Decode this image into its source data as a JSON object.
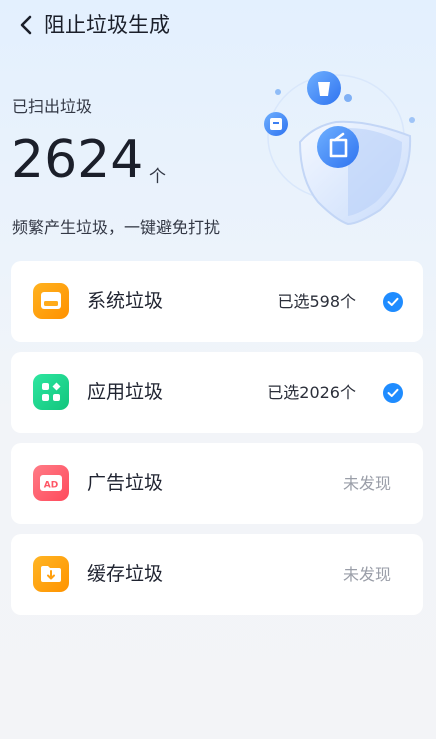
{
  "header": {
    "title": "阻止垃圾生成",
    "back_icon": "back-arrow-icon"
  },
  "summary": {
    "scanned_label": "已扫出垃圾",
    "count": "2624",
    "unit": "个",
    "description": "频繁产生垃圾，一键避免打扰"
  },
  "categories": [
    {
      "label": "系统垃圾",
      "status": "已选598个",
      "selected": true,
      "icon": "system-junk-icon",
      "color": "#ff9f0a"
    },
    {
      "label": "应用垃圾",
      "status": "已选2026个",
      "selected": true,
      "icon": "app-junk-icon",
      "color": "#1fcf8a"
    },
    {
      "label": "广告垃圾",
      "status": "未发现",
      "selected": false,
      "icon": "ad-junk-icon",
      "color": "#ff5a6a"
    },
    {
      "label": "缓存垃圾",
      "status": "未发现",
      "selected": false,
      "icon": "cache-junk-icon",
      "color": "#ffa20f"
    }
  ],
  "colors": {
    "accent": "#1f8cff",
    "muted": "#9a9ea8"
  }
}
